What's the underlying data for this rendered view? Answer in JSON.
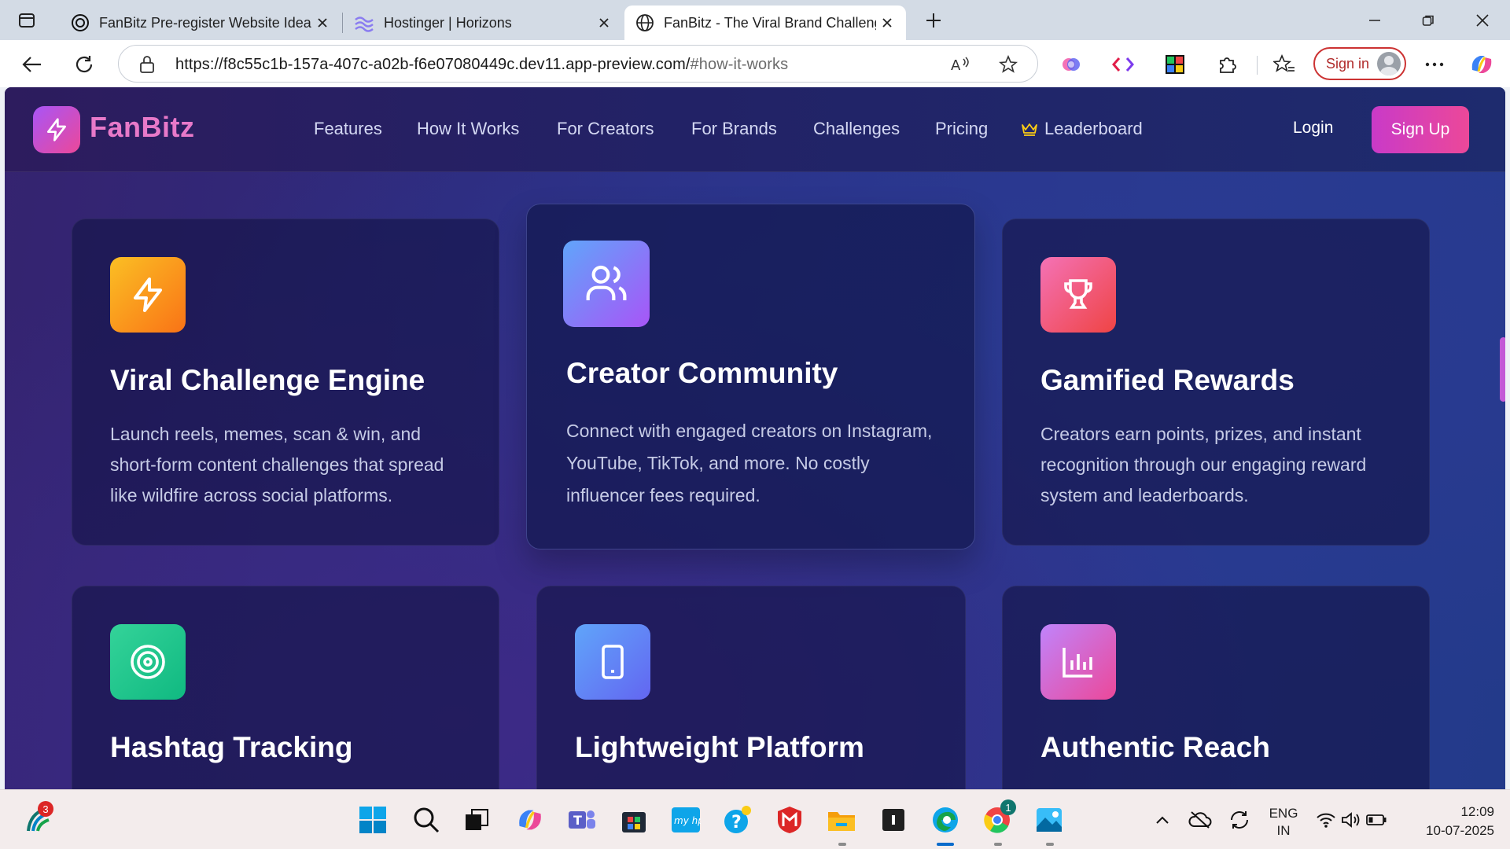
{
  "browser": {
    "tabs": [
      {
        "title": "FanBitz Pre-register Website Idea",
        "icon": "openai-icon"
      },
      {
        "title": "Hostinger | Horizons",
        "icon": "horizons-icon"
      },
      {
        "title": "FanBitz - The Viral Brand Challeng",
        "icon": "globe-icon"
      }
    ],
    "url_host": "https://f8c55c1b-157a-407c-a02b-f6e07080449c.dev11.app-preview.com/",
    "url_rest": "#how-it-works",
    "sign_in_label": "Sign in"
  },
  "site": {
    "brand": "FanBitz",
    "nav": {
      "features": "Features",
      "how_it_works": "How It Works",
      "for_creators": "For Creators",
      "for_brands": "For Brands",
      "challenges": "Challenges",
      "pricing": "Pricing",
      "leaderboard": "Leaderboard"
    },
    "login": "Login",
    "signup": "Sign Up",
    "features": [
      {
        "title": "Viral Challenge Engine",
        "desc": "Launch reels, memes, scan & win, and short-form content challenges that spread like wildfire across social platforms.",
        "icon": "lightning-icon",
        "gradient": [
          "#fbbf24",
          "#f97316"
        ]
      },
      {
        "title": "Creator Community",
        "desc": "Connect with engaged creators on Instagram, YouTube, TikTok, and more. No costly influencer fees required.",
        "icon": "users-icon",
        "gradient": [
          "#60a5fa",
          "#a855f7"
        ]
      },
      {
        "title": "Gamified Rewards",
        "desc": "Creators earn points, prizes, and instant recognition through our engaging reward system and leaderboards.",
        "icon": "trophy-icon",
        "gradient": [
          "#f472b6",
          "#ef4444"
        ]
      },
      {
        "title": "Hashtag Tracking",
        "icon": "target-icon",
        "gradient": [
          "#34d399",
          "#10b981"
        ]
      },
      {
        "title": "Lightweight Platform",
        "icon": "smartphone-icon",
        "gradient": [
          "#60a5fa",
          "#6366f1"
        ]
      },
      {
        "title": "Authentic Reach",
        "icon": "bar-chart-icon",
        "gradient": [
          "#c084fc",
          "#ec4899"
        ]
      }
    ]
  },
  "taskbar": {
    "lang_top": "ENG",
    "lang_bottom": "IN",
    "time": "12:09",
    "date": "10-07-2025",
    "badge_left": "3",
    "badge_chrome": "1"
  }
}
